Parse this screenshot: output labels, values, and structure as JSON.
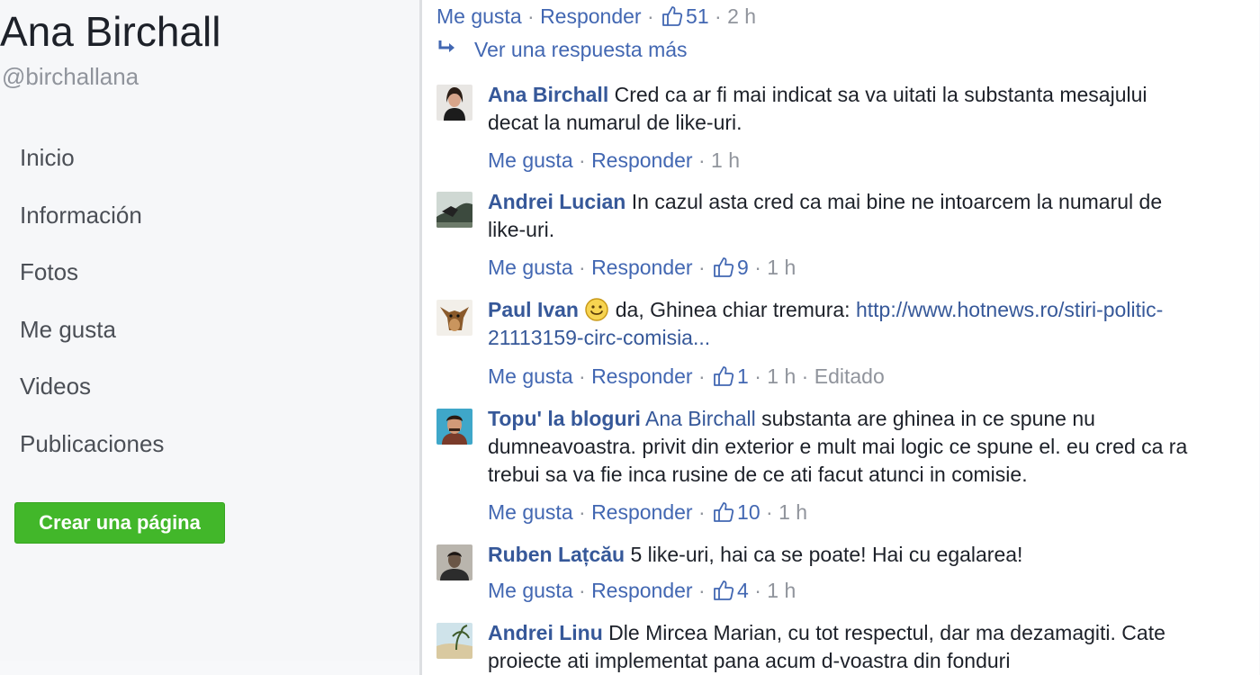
{
  "sidebar": {
    "page_name": "Ana Birchall",
    "handle": "@birchallana",
    "nav": [
      "Inicio",
      "Información",
      "Fotos",
      "Me gusta",
      "Videos",
      "Publicaciones"
    ],
    "create_page": "Crear una página"
  },
  "labels": {
    "like": "Me gusta",
    "reply": "Responder",
    "sep": "·",
    "edited": "Editado"
  },
  "top_actions": {
    "likes": "51",
    "time": "2 h"
  },
  "more_replies": "Ver una respuesta más",
  "comments": [
    {
      "author": "Ana Birchall",
      "text": "Cred ca ar fi mai indicat sa va uitati la substanta mesajului decat la numarul de like-uri.",
      "likes": "",
      "time": "1 h"
    },
    {
      "author": "Andrei Lucian",
      "text": "In cazul asta cred ca mai bine ne intoarcem la numarul de like-uri.",
      "likes": "9",
      "time": "1 h"
    },
    {
      "author": "Paul Ivan",
      "text": "da, Ghinea chiar tremura:",
      "link": "http://www.hotnews.ro/stiri-politic-21113159-circ-comisia...",
      "likes": "1",
      "time": "1 h",
      "edited": true,
      "emoji": "smiley-icon"
    },
    {
      "author": "Topu' la bloguri",
      "tag": "Ana Birchall",
      "text": "substanta are ghinea in ce spune nu dumneavoastra. privit din exterior e mult mai logic ce spune el. eu cred ca ra trebui sa va fie inca rusine de ce ati facut atunci in comisie.",
      "likes": "10",
      "time": "1 h"
    },
    {
      "author": "Ruben Lațcău",
      "text": "5 like-uri, hai ca se poate! Hai cu egalarea!",
      "likes": "4",
      "time": "1 h"
    },
    {
      "author": "Andrei Linu",
      "text": "Dle Mircea Marian, cu tot respectul, dar ma dezamagiti. Cate proiecte ati implementat pana acum d-voastra din fonduri"
    }
  ],
  "colors": {
    "link": "#365899",
    "meta": "#90949c",
    "button": "#42b72a"
  }
}
